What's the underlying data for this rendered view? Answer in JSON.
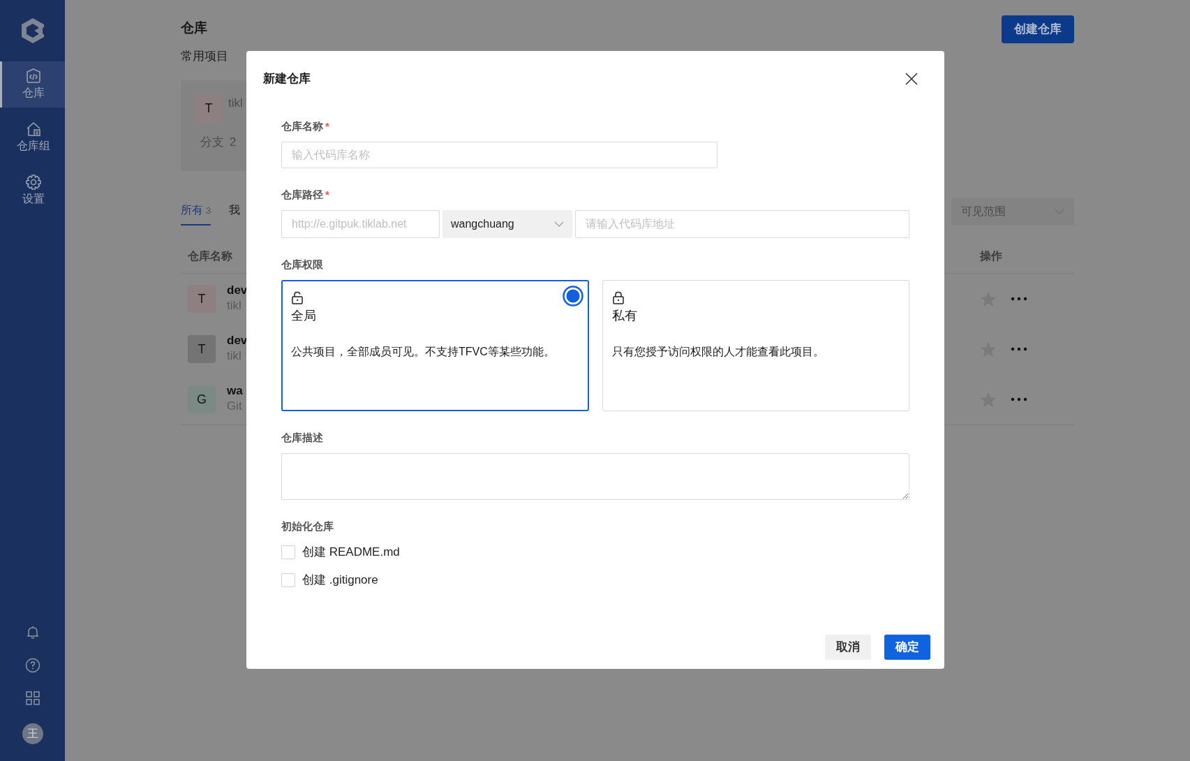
{
  "sidebar": {
    "items": [
      {
        "label": "仓库",
        "selected": true
      },
      {
        "label": "仓库组",
        "selected": false
      },
      {
        "label": "设置",
        "selected": false
      }
    ],
    "avatar": "王"
  },
  "page": {
    "title": "仓库",
    "create_button": "创建仓库",
    "recent_heading": "常用项目",
    "recent": [
      {
        "avatar": "T",
        "color": "#8e7f80",
        "name": "tikl",
        "branches_label": "分支",
        "branches": "2"
      }
    ],
    "tabs": [
      {
        "label": "所有",
        "count": "3",
        "selected": true
      },
      {
        "label": "我",
        "selected": false
      }
    ],
    "visibility_select": {
      "placeholder": "可见范围"
    },
    "table": {
      "columns": [
        "仓库名称",
        "操作"
      ],
      "rows": [
        {
          "avatar": "T",
          "color": "#8e7f80",
          "name": "dev",
          "sub": "tikl"
        },
        {
          "avatar": "T",
          "color": "#747474",
          "name": "dev",
          "sub": "tikl"
        },
        {
          "avatar": "G",
          "color": "#7c8a85",
          "name": "wa",
          "sub": "Git"
        }
      ]
    }
  },
  "dialog": {
    "title": "新建仓库",
    "name_field": {
      "label": "仓库名称",
      "required_mark": "*",
      "placeholder": "输入代码库名称"
    },
    "path_field": {
      "label": "仓库路径",
      "required_mark": "*",
      "prefix_placeholder": "http://e.gitpuk.tiklab.net",
      "owner": "wangchuang",
      "path_placeholder": "请输入代码库地址"
    },
    "permission": {
      "label": "仓库权限",
      "options": [
        {
          "title": "全局",
          "description": "公共项目，全部成员可见。不支持TFVC等某些功能。",
          "selected": true
        },
        {
          "title": "私有",
          "description": "只有您授予访问权限的人才能查看此项目。",
          "selected": false
        }
      ]
    },
    "description_field": {
      "label": "仓库描述"
    },
    "init": {
      "label": "初始化仓库",
      "options": [
        {
          "label": "创建 README.md",
          "checked": false
        },
        {
          "label": "创建 .gitignore",
          "checked": false
        }
      ]
    },
    "buttons": [
      {
        "label": "取消",
        "kind": "secondary"
      },
      {
        "label": "确定",
        "kind": "primary"
      }
    ]
  }
}
